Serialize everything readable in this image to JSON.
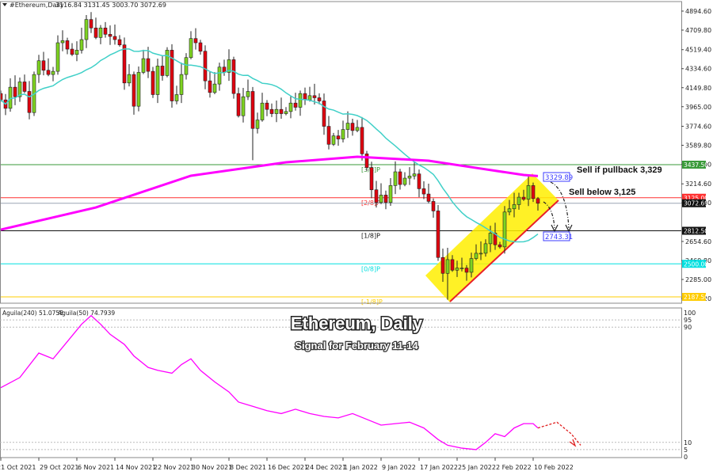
{
  "header": {
    "symbol": "#Ethereum,Daily",
    "ohlc": "3116.84 3131.45 3003.70 3072.69"
  },
  "indicator_header": {
    "a": "Aguila(240) 51.0758",
    "b": "Aguila(50) 74.7939"
  },
  "title": "Ethereum, Daily",
  "subtitle": "Signal for February 11-14",
  "annotations": {
    "sell_pullback": "Sell if pullback 3,329",
    "sell_below": "Sell below 3,125",
    "box_high": "3329.89",
    "box_low": "2743.31"
  },
  "colors": {
    "up": "#7ed321",
    "down": "#e0000f",
    "ma_fast": "#40d0c8",
    "ma_slow": "#ff00ff",
    "channel": "#ffee00"
  },
  "chart_data": {
    "type": "candlestick",
    "start_date": "21 Oct 2021",
    "price_axis": [
      "4894.60",
      "4709.80",
      "4519.40",
      "4334.60",
      "4149.80",
      "3965.00",
      "3774.60",
      "3589.80",
      "3405.00",
      "3214.60",
      "3029.80",
      "2654.60",
      "2469.80",
      "2285.00",
      "2100.20"
    ],
    "price_range": [
      2100.2,
      4894.6
    ],
    "date_axis": [
      "21 Oct 2021",
      "29 Oct 2021",
      "6 Nov 2021",
      "14 Nov 2021",
      "22 Nov 2021",
      "30 Nov 2021",
      "8 Dec 2021",
      "16 Dec 2021",
      "24 Dec 2021",
      "1 Jan 2022",
      "9 Jan 2022",
      "17 Jan 2022",
      "25 Jan 2022",
      "2 Feb 2022",
      "10 Feb 2022"
    ],
    "closes": [
      4050,
      3970,
      4170,
      4080,
      4220,
      4130,
      3930,
      4290,
      4420,
      4330,
      4290,
      4320,
      4590,
      4610,
      4530,
      4480,
      4520,
      4620,
      4810,
      4730,
      4640,
      4730,
      4670,
      4650,
      4620,
      4570,
      4210,
      4290,
      3990,
      4310,
      4440,
      4320,
      4100,
      4370,
      4280,
      4520,
      4040,
      4100,
      4290,
      4450,
      4630,
      4590,
      4510,
      4230,
      4120,
      4200,
      4360,
      4310,
      4430,
      4110,
      3900,
      4080,
      4130,
      3780,
      3860,
      4020,
      3960,
      3920,
      3960,
      3920,
      3940,
      4020,
      3980,
      4110,
      4050,
      4090,
      4070,
      4040,
      3800,
      3630,
      3710,
      3680,
      3770,
      3830,
      3760,
      3790,
      3540,
      3410,
      3200,
      3080,
      3150,
      3080,
      3240,
      3370,
      3250,
      3310,
      3330,
      3350,
      3210,
      3160,
      3090,
      3000,
      2560,
      2410,
      2540,
      2440,
      2460,
      2460,
      2420,
      2550,
      2600,
      2600,
      2690,
      2790,
      2680,
      2660,
      2990,
      3020,
      3060,
      3130,
      3110,
      3240,
      3116.84,
      3072.69
    ],
    "last_candle": {
      "open": 3116.84,
      "high": 3131.45,
      "low": 3003.7,
      "close": 3072.69
    },
    "ma_slow": [
      [
        0,
        2823
      ],
      [
        20,
        3033
      ],
      [
        40,
        3333
      ],
      [
        60,
        3460
      ],
      [
        75,
        3512
      ],
      [
        90,
        3475
      ],
      [
        100,
        3407
      ],
      [
        110,
        3340
      ],
      [
        113,
        3330
      ]
    ],
    "levels": [
      {
        "price": 3437.5,
        "tag": "3437.50",
        "label": "[3/8]P",
        "color": "#3a9a3a"
      },
      {
        "price": 3125.0,
        "tag": "3125.00",
        "label": "[2/8]P",
        "color": "#ff3030"
      },
      {
        "price": 3072.69,
        "tag": "3072.69",
        "label": "",
        "color": "#9aa6b4"
      },
      {
        "price": 2812.5,
        "tag": "2812.50",
        "label": "[1/8]P",
        "color": "#111111"
      },
      {
        "price": 2500.0,
        "tag": "2500.00",
        "label": "[0/8]P",
        "color": "#00e0e0"
      },
      {
        "price": 2187.5,
        "tag": "2187.50",
        "label": "[-1/8]P",
        "color": "#ffcc00"
      }
    ],
    "oscillator": {
      "axis": [
        "100",
        "95",
        "90",
        "10",
        "5",
        "0"
      ],
      "values": [
        [
          0,
          48
        ],
        [
          4,
          55
        ],
        [
          8,
          72
        ],
        [
          11,
          68
        ],
        [
          14,
          80
        ],
        [
          17,
          92
        ],
        [
          19,
          98
        ],
        [
          21,
          92
        ],
        [
          23,
          85
        ],
        [
          26,
          78
        ],
        [
          28,
          70
        ],
        [
          31,
          62
        ],
        [
          33,
          60
        ],
        [
          36,
          58
        ],
        [
          38,
          64
        ],
        [
          40,
          68
        ],
        [
          42,
          60
        ],
        [
          45,
          52
        ],
        [
          48,
          45
        ],
        [
          50,
          38
        ],
        [
          53,
          35
        ],
        [
          56,
          32
        ],
        [
          59,
          30
        ],
        [
          62,
          33
        ],
        [
          65,
          30
        ],
        [
          68,
          28
        ],
        [
          71,
          27
        ],
        [
          74,
          30
        ],
        [
          77,
          26
        ],
        [
          80,
          22
        ],
        [
          83,
          23
        ],
        [
          86,
          24
        ],
        [
          89,
          20
        ],
        [
          92,
          12
        ],
        [
          94,
          8
        ],
        [
          97,
          6
        ],
        [
          100,
          5
        ],
        [
          102,
          10
        ],
        [
          104,
          16
        ],
        [
          106,
          14
        ],
        [
          108,
          20
        ],
        [
          110,
          23
        ],
        [
          112,
          23
        ],
        [
          113,
          20
        ]
      ],
      "projection": [
        [
          113,
          20
        ],
        [
          117,
          24
        ],
        [
          120,
          16
        ],
        [
          122,
          8
        ]
      ]
    }
  }
}
